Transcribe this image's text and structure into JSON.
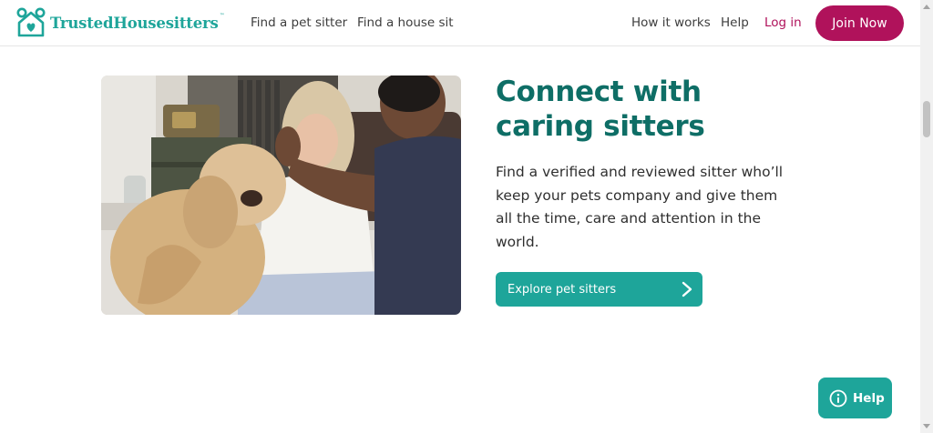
{
  "header": {
    "logo_text": "TrustedHousesitters",
    "logo_tm": "™",
    "nav_left": [
      "Find a pet sitter",
      "Find a house sit"
    ],
    "nav_right": [
      "How it works",
      "Help"
    ],
    "login_label": "Log in",
    "join_label": "Join Now"
  },
  "hero": {
    "photo_icon": "photo-of-couple-with-dog",
    "title": "Connect with caring sitters",
    "body": "Find a verified and reviewed sitter who’ll keep your pets company and give them all the time, care and attention in the world.",
    "cta_label": "Explore pet sitters",
    "cta_icon": "chevron-right-icon"
  },
  "help_widget": {
    "label": "Help",
    "icon": "info-icon"
  },
  "colors": {
    "brand_teal": "#1ea59a",
    "heading_teal": "#0e6e66",
    "accent_magenta": "#b0125b"
  }
}
